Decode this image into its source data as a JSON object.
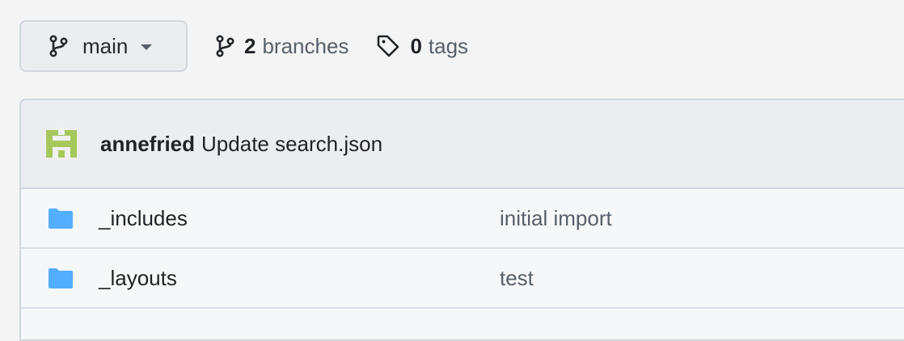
{
  "branch_selector": {
    "label": "main",
    "icon": "git-branch-icon"
  },
  "branches": {
    "count": "2",
    "label": "branches",
    "icon": "git-branch-icon"
  },
  "tags": {
    "count": "0",
    "label": "tags",
    "icon": "tag-icon"
  },
  "latest_commit": {
    "author": "annefried",
    "message": "Update search.json",
    "avatar_colors": {
      "primary": "#a6c85a",
      "background": "#eef0f2"
    }
  },
  "files": [
    {
      "name": "_includes",
      "commit_message": "initial import",
      "icon": "folder-icon"
    },
    {
      "name": "_layouts",
      "commit_message": "test",
      "icon": "folder-icon"
    }
  ],
  "colors": {
    "folder": "#54aeff",
    "border": "#d0d7de",
    "muted_text": "#57606a"
  }
}
